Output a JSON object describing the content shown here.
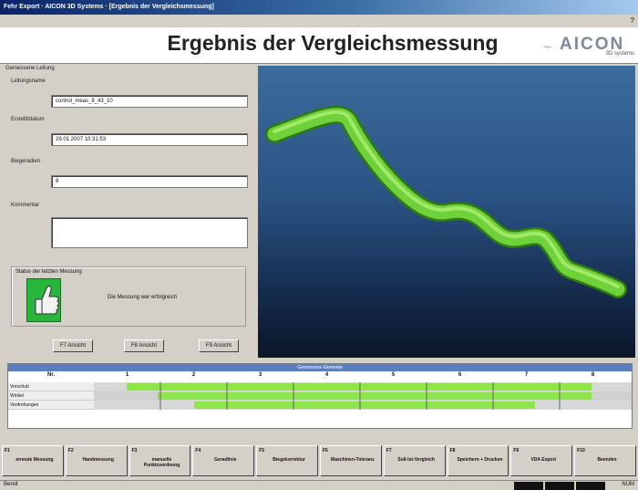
{
  "window": {
    "title": "Fehr Export · AICON 3D Systems · [Ergebnis der Vergleichsmessung]"
  },
  "header": {
    "title": "Ergebnis der Vergleichsmessung",
    "logo": "AICON",
    "logo_sub": "3D systems"
  },
  "left": {
    "section": "Gemessene Leitung",
    "fields": [
      {
        "label": "Leitungsname",
        "value": "control_meas_8_43_10"
      },
      {
        "label": "Erstellt/datum",
        "value": "29.01.2007 10:31:53"
      },
      {
        "label": "Biegeradien",
        "value": "8"
      }
    ],
    "comment_label": "Kommentar",
    "status_title": "Status der letzten Messung",
    "status_text": "Die Messung war erfolgreich",
    "buttons": [
      "F7 Ansicht",
      "F8 Ansicht",
      "F9 Ansicht"
    ]
  },
  "table": {
    "title": "Gemessene Elemente",
    "first_col": "Nr.",
    "columns": [
      "1",
      "2",
      "3",
      "4",
      "5",
      "6",
      "7",
      "8"
    ],
    "rows": [
      "Vorschub",
      "Winkel",
      "Verdrehungen"
    ]
  },
  "fkeys": [
    {
      "num": "F1",
      "label": "erneute Messung"
    },
    {
      "num": "F2",
      "label": "Handmessung"
    },
    {
      "num": "F3",
      "label": "manuelle Punktzuordnung"
    },
    {
      "num": "F4",
      "label": "Geradlinie"
    },
    {
      "num": "F5",
      "label": "Biegekorrektur"
    },
    {
      "num": "F6",
      "label": "Maschinen-Toleranz"
    },
    {
      "num": "F7",
      "label": "Soll-Ist-Vergleich"
    },
    {
      "num": "F8",
      "label": "Speichern + Drucken"
    },
    {
      "num": "F9",
      "label": "VDA Export"
    },
    {
      "num": "F10",
      "label": "Beenden"
    }
  ],
  "statusbar": {
    "left": "Bereit",
    "right": "NUM"
  },
  "colors": {
    "tube": "#6fd23a",
    "viewport_top": "#3b6c9c",
    "viewport_bottom": "#0b1628",
    "table_head": "#5a7fc0",
    "fill_green": "#8ee64a"
  }
}
